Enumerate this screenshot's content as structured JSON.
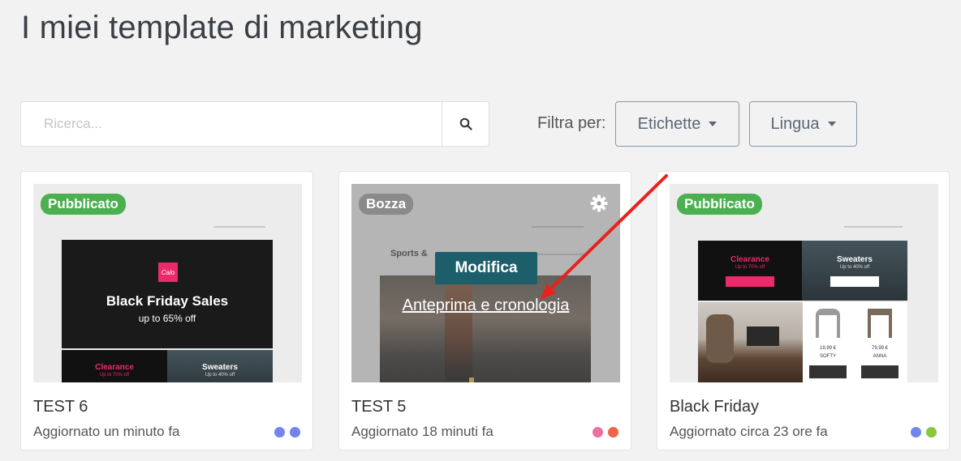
{
  "page": {
    "title": "I miei template di marketing"
  },
  "search": {
    "placeholder": "Ricerca..."
  },
  "filters": {
    "label": "Filtra per:",
    "tags_label": "Etichette",
    "language_label": "Lingua"
  },
  "cards": [
    {
      "title": "TEST 6",
      "updated": "Aggiornato un minuto fa",
      "status": "Pubblicato",
      "status_color": "#4caf50",
      "dots": [
        "#6f86ee",
        "#6f86ee"
      ],
      "preview": {
        "logo_text": "Calo",
        "headline": "Black Friday Sales",
        "subline": "up to 65% off",
        "tile_left_title": "Clearance",
        "tile_left_sub": "Up to 70% off",
        "tile_right_title": "Sweaters",
        "tile_right_sub": "Up to 40% off"
      }
    },
    {
      "title": "TEST 5",
      "updated": "Aggiornato 18 minuti fa",
      "status": "Bozza",
      "dots": [
        "#ef6fa3",
        "#f26148"
      ],
      "preview": {
        "heading": "Sports &"
      },
      "hover": {
        "edit_label": "Modifica",
        "preview_label": "Anteprima e cronologia"
      }
    },
    {
      "title": "Black Friday",
      "updated": "Aggiornato circa 23 ore fa",
      "status": "Pubblicato",
      "status_color": "#4caf50",
      "dots": [
        "#6f86ee",
        "#8bc53f"
      ],
      "preview": {
        "tile_left_title": "Clearance",
        "tile_left_sub": "Up to 70% off",
        "tile_right_title": "Sweaters",
        "tile_right_sub": "Up to 40% off",
        "item1_price": "19,99 €",
        "item1_name": "SOFTY",
        "item2_price": "79,99 €",
        "item2_name": "ANNA"
      }
    }
  ],
  "colors": {
    "background": "#f2f2f2",
    "edit_button": "#1c5f6b",
    "annotation_arrow": "#e8221b",
    "hero_pink": "#ec2a6b"
  },
  "icons": {
    "search": "search-icon",
    "settings": "gear-icon",
    "dropdown": "caret-down-icon"
  }
}
